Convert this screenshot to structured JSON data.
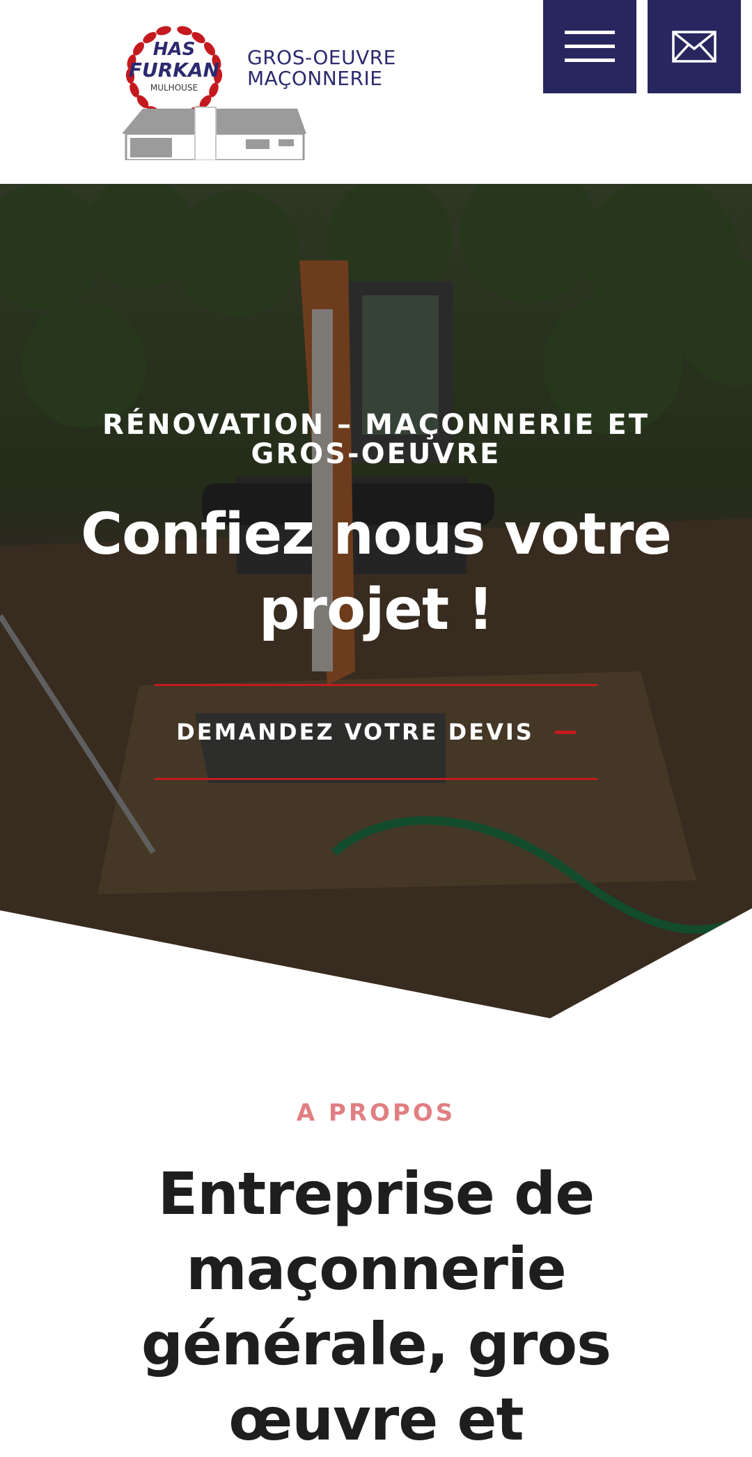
{
  "header": {
    "logo": {
      "brand_line1": "HAS",
      "brand_line2": "FURKAN",
      "brand_city": "MULHOUSE",
      "tagline_line1": "GROS-OEUVRE",
      "tagline_line2": "MAÇONNERIE"
    },
    "menu_icon": "hamburger-icon",
    "mail_icon": "envelope-icon"
  },
  "hero": {
    "eyebrow": "RÉNOVATION – MAÇONNERIE ET GROS-OEUVRE",
    "title": "Confiez nous votre projet !",
    "cta_label": "DEMANDEZ VOTRE DEVIS"
  },
  "about": {
    "label": "A PROPOS",
    "title": "Entreprise de maçonnerie générale, gros œuvre et"
  },
  "colors": {
    "navy": "#27265e",
    "accent_red": "#c41a1f",
    "about_label": "#e07f82",
    "heading_dark": "#1e1e1e"
  }
}
